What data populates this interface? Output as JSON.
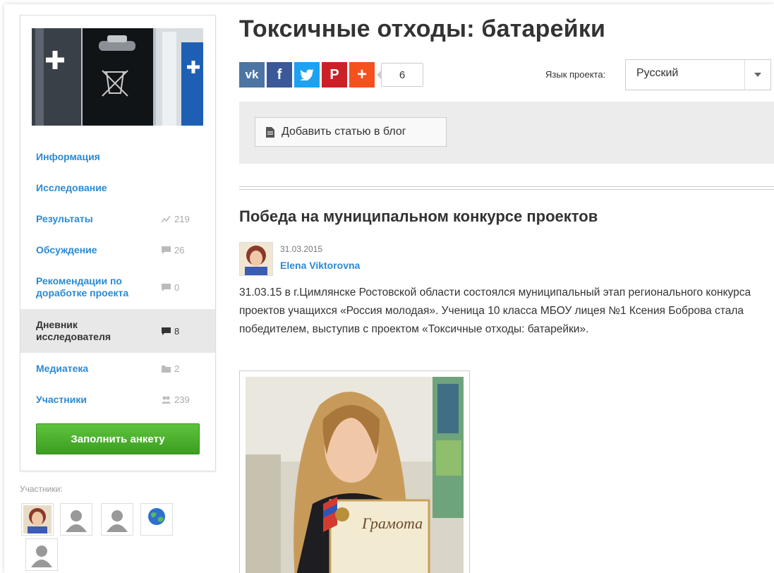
{
  "project": {
    "title": "Токсичные отходы: батарейки",
    "share_count": "6",
    "language_label": "Язык проекта:",
    "language_value": "Русский",
    "add_article_label": "Добавить статью в блог"
  },
  "sidebar": {
    "items": [
      {
        "label": "Информация",
        "count": ""
      },
      {
        "label": "Исследование",
        "count": ""
      },
      {
        "label": "Результаты",
        "count": "219",
        "icon": "chart-icon"
      },
      {
        "label": "Обсуждение",
        "count": "26",
        "icon": "comment-icon"
      },
      {
        "label": "Рекомендации по доработке проекта",
        "count": "0",
        "icon": "comment-icon"
      },
      {
        "label": "Дневник исследователя",
        "count": "8",
        "icon": "comment-icon",
        "active": true
      },
      {
        "label": "Медиатека",
        "count": "2",
        "icon": "folder-icon"
      },
      {
        "label": "Участники",
        "count": "239",
        "icon": "users-icon"
      }
    ],
    "fill_button": "Заполнить анкету",
    "members_label": "Участники:"
  },
  "post": {
    "title": "Победа на муниципальном конкурсе проектов",
    "date": "31.03.2015",
    "author": "Elena Viktorovna",
    "text": "31.03.15 в г.Цимлянске Ростовской области состоялся муниципальный этап регионального конкурса проектов учащихся «Россия молодая». Ученица 10 класса МБОУ лицея №1 Ксения Боброва стала победителем, выступив с проектом «Токсичные отходы: батарейки».",
    "photo_caption": "Грамота"
  },
  "colors": {
    "link": "#2a8ad4",
    "green": "#4cae2c",
    "vk": "#4c75a3",
    "facebook": "#3b5998",
    "twitter": "#1da1f2",
    "pinterest": "#cb2027",
    "plus": "#f4511e"
  }
}
